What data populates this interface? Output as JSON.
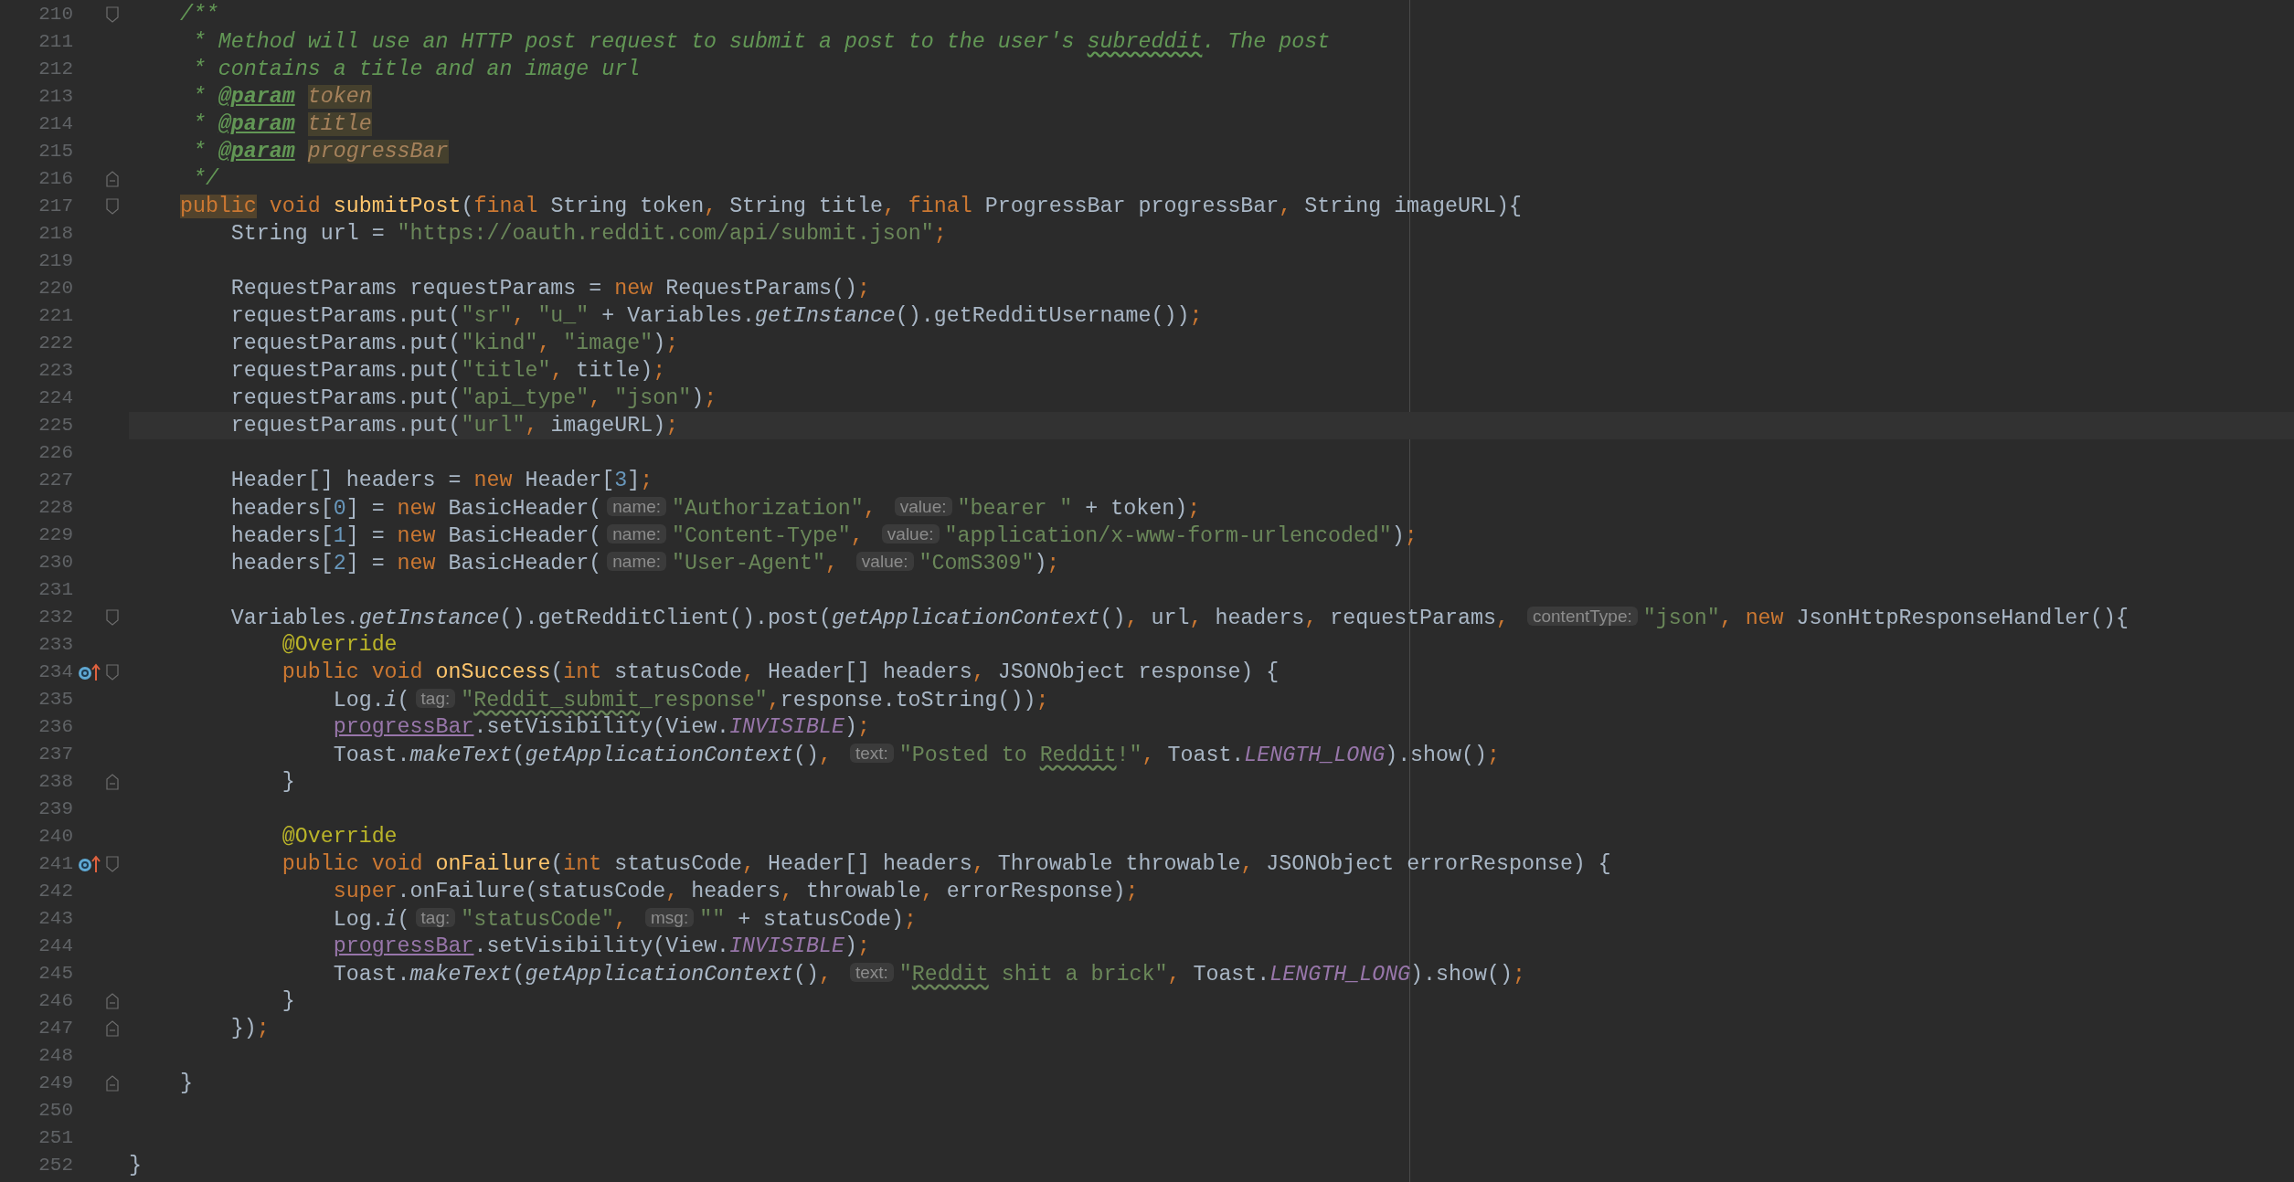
{
  "editor": {
    "lines": [
      {
        "number": "210",
        "fold_start": true,
        "fold_end": false,
        "override": false,
        "current": false,
        "tokens": [
          {
            "kind": "comment",
            "text": "    /**"
          }
        ]
      },
      {
        "number": "211",
        "fold_start": false,
        "fold_end": false,
        "override": false,
        "current": false,
        "tokens": [
          {
            "kind": "comment",
            "text": "     * Method will use an HTTP post request to submit a post to the user's "
          },
          {
            "kind": "comment_typo",
            "text": "subreddit"
          },
          {
            "kind": "comment",
            "text": ". The post"
          }
        ]
      },
      {
        "number": "212",
        "fold_start": false,
        "fold_end": false,
        "override": false,
        "current": false,
        "tokens": [
          {
            "kind": "comment",
            "text": "     * contains a title and an image url"
          }
        ]
      },
      {
        "number": "213",
        "fold_start": false,
        "fold_end": false,
        "override": false,
        "current": false,
        "tokens": [
          {
            "kind": "comment",
            "text": "     * "
          },
          {
            "kind": "doc_tag",
            "text": "@param"
          },
          {
            "kind": "doc_param",
            "text": " token"
          }
        ]
      },
      {
        "number": "214",
        "fold_start": false,
        "fold_end": false,
        "override": false,
        "current": false,
        "tokens": [
          {
            "kind": "comment",
            "text": "     * "
          },
          {
            "kind": "doc_tag",
            "text": "@param"
          },
          {
            "kind": "doc_param",
            "text": " title"
          }
        ]
      },
      {
        "number": "215",
        "fold_start": false,
        "fold_end": false,
        "override": false,
        "current": false,
        "tokens": [
          {
            "kind": "comment",
            "text": "     * "
          },
          {
            "kind": "doc_tag",
            "text": "@param"
          },
          {
            "kind": "doc_param",
            "text": " progressBar"
          }
        ]
      },
      {
        "number": "216",
        "fold_start": false,
        "fold_end": true,
        "override": false,
        "current": false,
        "tokens": [
          {
            "kind": "comment",
            "text": "     */"
          }
        ]
      },
      {
        "number": "217",
        "fold_start": true,
        "fold_end": false,
        "override": false,
        "current": false,
        "tokens": [
          {
            "kind": "keyword_marked",
            "text": "    public"
          },
          {
            "kind": "keyword",
            "text": " void"
          },
          {
            "kind": "declaration",
            "text": " submitPost"
          },
          {
            "kind": "plain",
            "text": "("
          },
          {
            "kind": "keyword",
            "text": "final"
          },
          {
            "kind": "plain",
            "text": " String token"
          },
          {
            "kind": "keyword",
            "text": ","
          },
          {
            "kind": "plain",
            "text": " String title"
          },
          {
            "kind": "keyword",
            "text": ","
          },
          {
            "kind": "keyword",
            "text": " final"
          },
          {
            "kind": "plain",
            "text": " ProgressBar progressBar"
          },
          {
            "kind": "keyword",
            "text": ","
          },
          {
            "kind": "plain",
            "text": " String imageURL){"
          }
        ]
      },
      {
        "number": "218",
        "fold_start": false,
        "fold_end": false,
        "override": false,
        "current": false,
        "tokens": [
          {
            "kind": "plain",
            "text": "        String url = "
          },
          {
            "kind": "string",
            "text": "\"https://oauth.reddit.com/api/submit.json\""
          },
          {
            "kind": "keyword",
            "text": ";"
          }
        ]
      },
      {
        "number": "219",
        "fold_start": false,
        "fold_end": false,
        "override": false,
        "current": false
      },
      {
        "number": "220",
        "fold_start": false,
        "fold_end": false,
        "override": false,
        "current": false,
        "tokens": [
          {
            "kind": "plain",
            "text": "        RequestParams requestParams = "
          },
          {
            "kind": "keyword",
            "text": "new"
          },
          {
            "kind": "plain",
            "text": " RequestParams()"
          },
          {
            "kind": "keyword",
            "text": ";"
          }
        ]
      },
      {
        "number": "221",
        "fold_start": false,
        "fold_end": false,
        "override": false,
        "current": false,
        "tokens": [
          {
            "kind": "plain",
            "text": "        requestParams.put("
          },
          {
            "kind": "string",
            "text": "\"sr\""
          },
          {
            "kind": "keyword",
            "text": ","
          },
          {
            "kind": "string",
            "text": " \"u_\""
          },
          {
            "kind": "plain",
            "text": " + Variables."
          },
          {
            "kind": "static_method",
            "text": "getInstance"
          },
          {
            "kind": "plain",
            "text": "().getRedditUsername())"
          },
          {
            "kind": "keyword",
            "text": ";"
          }
        ]
      },
      {
        "number": "222",
        "fold_start": false,
        "fold_end": false,
        "override": false,
        "current": false,
        "tokens": [
          {
            "kind": "plain",
            "text": "        requestParams.put("
          },
          {
            "kind": "string",
            "text": "\"kind\""
          },
          {
            "kind": "keyword",
            "text": ","
          },
          {
            "kind": "string",
            "text": " \"image\""
          },
          {
            "kind": "plain",
            "text": ")"
          },
          {
            "kind": "keyword",
            "text": ";"
          }
        ]
      },
      {
        "number": "223",
        "fold_start": false,
        "fold_end": false,
        "override": false,
        "current": false,
        "tokens": [
          {
            "kind": "plain",
            "text": "        requestParams.put("
          },
          {
            "kind": "string",
            "text": "\"title\""
          },
          {
            "kind": "keyword",
            "text": ","
          },
          {
            "kind": "plain",
            "text": " title)"
          },
          {
            "kind": "keyword",
            "text": ";"
          }
        ]
      },
      {
        "number": "224",
        "fold_start": false,
        "fold_end": false,
        "override": false,
        "current": false,
        "tokens": [
          {
            "kind": "plain",
            "text": "        requestParams.put("
          },
          {
            "kind": "string",
            "text": "\"api_type\""
          },
          {
            "kind": "keyword",
            "text": ","
          },
          {
            "kind": "string",
            "text": " \"json\""
          },
          {
            "kind": "plain",
            "text": ")"
          },
          {
            "kind": "keyword",
            "text": ";"
          }
        ]
      },
      {
        "number": "225",
        "fold_start": false,
        "fold_end": false,
        "override": false,
        "current": true,
        "tokens": [
          {
            "kind": "plain",
            "text": "        requestParams.put("
          },
          {
            "kind": "string",
            "text": "\"url\""
          },
          {
            "kind": "keyword",
            "text": ","
          },
          {
            "kind": "plain",
            "text": " imageURL)"
          },
          {
            "kind": "keyword",
            "text": ";"
          }
        ]
      },
      {
        "number": "226",
        "fold_start": false,
        "fold_end": false,
        "override": false,
        "current": false
      },
      {
        "number": "227",
        "fold_start": false,
        "fold_end": false,
        "override": false,
        "current": false,
        "tokens": [
          {
            "kind": "plain",
            "text": "        Header[] headers = "
          },
          {
            "kind": "keyword",
            "text": "new"
          },
          {
            "kind": "plain",
            "text": " Header["
          },
          {
            "kind": "number",
            "text": "3"
          },
          {
            "kind": "plain",
            "text": "]"
          },
          {
            "kind": "keyword",
            "text": ";"
          }
        ]
      },
      {
        "number": "228",
        "fold_start": false,
        "fold_end": false,
        "override": false,
        "current": false,
        "tokens": [
          {
            "kind": "plain",
            "text": "        headers["
          },
          {
            "kind": "number",
            "text": "0"
          },
          {
            "kind": "plain",
            "text": "] = "
          },
          {
            "kind": "keyword",
            "text": "new"
          },
          {
            "kind": "plain",
            "text": " BasicHeader("
          },
          {
            "kind": "hint",
            "text": "name:"
          },
          {
            "kind": "string",
            "text": "\"Authorization\""
          },
          {
            "kind": "keyword",
            "text": ","
          },
          {
            "kind": "hint",
            "text": " value:"
          },
          {
            "kind": "string",
            "text": "\"bearer \""
          },
          {
            "kind": "plain",
            "text": " + token)"
          },
          {
            "kind": "keyword",
            "text": ";"
          }
        ]
      },
      {
        "number": "229",
        "fold_start": false,
        "fold_end": false,
        "override": false,
        "current": false,
        "tokens": [
          {
            "kind": "plain",
            "text": "        headers["
          },
          {
            "kind": "number",
            "text": "1"
          },
          {
            "kind": "plain",
            "text": "] = "
          },
          {
            "kind": "keyword",
            "text": "new"
          },
          {
            "kind": "plain",
            "text": " BasicHeader("
          },
          {
            "kind": "hint",
            "text": "name:"
          },
          {
            "kind": "string",
            "text": "\"Content-Type\""
          },
          {
            "kind": "keyword",
            "text": ","
          },
          {
            "kind": "hint",
            "text": " value:"
          },
          {
            "kind": "string",
            "text": "\"application/x-www-form-urlencoded\""
          },
          {
            "kind": "plain",
            "text": ")"
          },
          {
            "kind": "keyword",
            "text": ";"
          }
        ]
      },
      {
        "number": "230",
        "fold_start": false,
        "fold_end": false,
        "override": false,
        "current": false,
        "tokens": [
          {
            "kind": "plain",
            "text": "        headers["
          },
          {
            "kind": "number",
            "text": "2"
          },
          {
            "kind": "plain",
            "text": "] = "
          },
          {
            "kind": "keyword",
            "text": "new"
          },
          {
            "kind": "plain",
            "text": " BasicHeader("
          },
          {
            "kind": "hint",
            "text": "name:"
          },
          {
            "kind": "string",
            "text": "\"User-Agent\""
          },
          {
            "kind": "keyword",
            "text": ","
          },
          {
            "kind": "hint",
            "text": " value:"
          },
          {
            "kind": "string",
            "text": "\"ComS309\""
          },
          {
            "kind": "plain",
            "text": ")"
          },
          {
            "kind": "keyword",
            "text": ";"
          }
        ]
      },
      {
        "number": "231",
        "fold_start": false,
        "fold_end": false,
        "override": false,
        "current": false
      },
      {
        "number": "232",
        "fold_start": true,
        "fold_end": false,
        "override": false,
        "current": false,
        "tokens": [
          {
            "kind": "plain",
            "text": "        Variables."
          },
          {
            "kind": "static_method",
            "text": "getInstance"
          },
          {
            "kind": "plain",
            "text": "().getRedditClient().post("
          },
          {
            "kind": "static_method",
            "text": "getApplicationContext"
          },
          {
            "kind": "plain",
            "text": "()"
          },
          {
            "kind": "keyword",
            "text": ","
          },
          {
            "kind": "plain",
            "text": " url"
          },
          {
            "kind": "keyword",
            "text": ","
          },
          {
            "kind": "plain",
            "text": " headers"
          },
          {
            "kind": "keyword",
            "text": ","
          },
          {
            "kind": "plain",
            "text": " requestParams"
          },
          {
            "kind": "keyword",
            "text": ","
          },
          {
            "kind": "hint",
            "text": " contentType:"
          },
          {
            "kind": "string",
            "text": "\"json\""
          },
          {
            "kind": "keyword",
            "text": ","
          },
          {
            "kind": "keyword",
            "text": " new"
          },
          {
            "kind": "plain",
            "text": " JsonHttpResponseHandler(){"
          }
        ]
      },
      {
        "number": "233",
        "fold_start": false,
        "fold_end": false,
        "override": false,
        "current": false,
        "tokens": [
          {
            "kind": "annotation",
            "text": "            @Override"
          }
        ]
      },
      {
        "number": "234",
        "fold_start": true,
        "fold_end": false,
        "override": true,
        "current": false,
        "tokens": [
          {
            "kind": "keyword",
            "text": "            public"
          },
          {
            "kind": "keyword",
            "text": " void"
          },
          {
            "kind": "declaration",
            "text": " onSuccess"
          },
          {
            "kind": "plain",
            "text": "("
          },
          {
            "kind": "keyword",
            "text": "int"
          },
          {
            "kind": "plain",
            "text": " statusCode"
          },
          {
            "kind": "keyword",
            "text": ","
          },
          {
            "kind": "plain",
            "text": " Header[] headers"
          },
          {
            "kind": "keyword",
            "text": ","
          },
          {
            "kind": "plain",
            "text": " JSONObject response) {"
          }
        ]
      },
      {
        "number": "235",
        "fold_start": false,
        "fold_end": false,
        "override": false,
        "current": false,
        "tokens": [
          {
            "kind": "plain",
            "text": "                Log."
          },
          {
            "kind": "static_method",
            "text": "i"
          },
          {
            "kind": "plain",
            "text": "("
          },
          {
            "kind": "hint",
            "text": "tag:"
          },
          {
            "kind": "string",
            "text": "\""
          },
          {
            "kind": "string_typo",
            "text": "Reddit_submit"
          },
          {
            "kind": "string",
            "text": "_response\""
          },
          {
            "kind": "keyword",
            "text": ","
          },
          {
            "kind": "plain",
            "text": "response.toString())"
          },
          {
            "kind": "keyword",
            "text": ";"
          }
        ]
      },
      {
        "number": "236",
        "fold_start": false,
        "fold_end": false,
        "override": false,
        "current": false,
        "tokens": [
          {
            "kind": "field",
            "text": "                progressBar"
          },
          {
            "kind": "plain",
            "text": ".setVisibility(View."
          },
          {
            "kind": "constant",
            "text": "INVISIBLE"
          },
          {
            "kind": "plain",
            "text": ")"
          },
          {
            "kind": "keyword",
            "text": ";"
          }
        ]
      },
      {
        "number": "237",
        "fold_start": false,
        "fold_end": false,
        "override": false,
        "current": false,
        "tokens": [
          {
            "kind": "plain",
            "text": "                Toast."
          },
          {
            "kind": "static_method",
            "text": "makeText"
          },
          {
            "kind": "plain",
            "text": "("
          },
          {
            "kind": "static_method",
            "text": "getApplicationContext"
          },
          {
            "kind": "plain",
            "text": "()"
          },
          {
            "kind": "keyword",
            "text": ","
          },
          {
            "kind": "hint",
            "text": " text:"
          },
          {
            "kind": "string",
            "text": "\"Posted to "
          },
          {
            "kind": "string_typo",
            "text": "Reddit"
          },
          {
            "kind": "string",
            "text": "!\""
          },
          {
            "kind": "keyword",
            "text": ","
          },
          {
            "kind": "plain",
            "text": " Toast."
          },
          {
            "kind": "constant",
            "text": "LENGTH_LONG"
          },
          {
            "kind": "plain",
            "text": ").show()"
          },
          {
            "kind": "keyword",
            "text": ";"
          }
        ]
      },
      {
        "number": "238",
        "fold_start": false,
        "fold_end": true,
        "override": false,
        "current": false,
        "tokens": [
          {
            "kind": "plain",
            "text": "            }"
          }
        ]
      },
      {
        "number": "239",
        "fold_start": false,
        "fold_end": false,
        "override": false,
        "current": false
      },
      {
        "number": "240",
        "fold_start": false,
        "fold_end": false,
        "override": false,
        "current": false,
        "tokens": [
          {
            "kind": "annotation",
            "text": "            @Override"
          }
        ]
      },
      {
        "number": "241",
        "fold_start": true,
        "fold_end": false,
        "override": true,
        "current": false,
        "tokens": [
          {
            "kind": "keyword",
            "text": "            public"
          },
          {
            "kind": "keyword",
            "text": " void"
          },
          {
            "kind": "declaration",
            "text": " onFailure"
          },
          {
            "kind": "plain",
            "text": "("
          },
          {
            "kind": "keyword",
            "text": "int"
          },
          {
            "kind": "plain",
            "text": " statusCode"
          },
          {
            "kind": "keyword",
            "text": ","
          },
          {
            "kind": "plain",
            "text": " Header[] headers"
          },
          {
            "kind": "keyword",
            "text": ","
          },
          {
            "kind": "plain",
            "text": " Throwable throwable"
          },
          {
            "kind": "keyword",
            "text": ","
          },
          {
            "kind": "plain",
            "text": " JSONObject errorResponse) {"
          }
        ]
      },
      {
        "number": "242",
        "fold_start": false,
        "fold_end": false,
        "override": false,
        "current": false,
        "tokens": [
          {
            "kind": "keyword",
            "text": "                super"
          },
          {
            "kind": "plain",
            "text": ".onFailure(statusCode"
          },
          {
            "kind": "keyword",
            "text": ","
          },
          {
            "kind": "plain",
            "text": " headers"
          },
          {
            "kind": "keyword",
            "text": ","
          },
          {
            "kind": "plain",
            "text": " throwable"
          },
          {
            "kind": "keyword",
            "text": ","
          },
          {
            "kind": "plain",
            "text": " errorResponse)"
          },
          {
            "kind": "keyword",
            "text": ";"
          }
        ]
      },
      {
        "number": "243",
        "fold_start": false,
        "fold_end": false,
        "override": false,
        "current": false,
        "tokens": [
          {
            "kind": "plain",
            "text": "                Log."
          },
          {
            "kind": "static_method",
            "text": "i"
          },
          {
            "kind": "plain",
            "text": "("
          },
          {
            "kind": "hint",
            "text": "tag:"
          },
          {
            "kind": "string",
            "text": "\"statusCode\""
          },
          {
            "kind": "keyword",
            "text": ","
          },
          {
            "kind": "hint",
            "text": " msg:"
          },
          {
            "kind": "string",
            "text": "\"\""
          },
          {
            "kind": "plain",
            "text": " + statusCode)"
          },
          {
            "kind": "keyword",
            "text": ";"
          }
        ]
      },
      {
        "number": "244",
        "fold_start": false,
        "fold_end": false,
        "override": false,
        "current": false,
        "tokens": [
          {
            "kind": "field",
            "text": "                progressBar"
          },
          {
            "kind": "plain",
            "text": ".setVisibility(View."
          },
          {
            "kind": "constant",
            "text": "INVISIBLE"
          },
          {
            "kind": "plain",
            "text": ")"
          },
          {
            "kind": "keyword",
            "text": ";"
          }
        ]
      },
      {
        "number": "245",
        "fold_start": false,
        "fold_end": false,
        "override": false,
        "current": false,
        "tokens": [
          {
            "kind": "plain",
            "text": "                Toast."
          },
          {
            "kind": "static_method",
            "text": "makeText"
          },
          {
            "kind": "plain",
            "text": "("
          },
          {
            "kind": "static_method",
            "text": "getApplicationContext"
          },
          {
            "kind": "plain",
            "text": "()"
          },
          {
            "kind": "keyword",
            "text": ","
          },
          {
            "kind": "hint",
            "text": " text:"
          },
          {
            "kind": "string",
            "text": "\""
          },
          {
            "kind": "string_typo",
            "text": "Reddit"
          },
          {
            "kind": "string",
            "text": " shit a brick\""
          },
          {
            "kind": "keyword",
            "text": ","
          },
          {
            "kind": "plain",
            "text": " Toast."
          },
          {
            "kind": "constant",
            "text": "LENGTH_LONG"
          },
          {
            "kind": "plain",
            "text": ").show()"
          },
          {
            "kind": "keyword",
            "text": ";"
          }
        ]
      },
      {
        "number": "246",
        "fold_start": false,
        "fold_end": true,
        "override": false,
        "current": false,
        "tokens": [
          {
            "kind": "plain",
            "text": "            }"
          }
        ]
      },
      {
        "number": "247",
        "fold_start": false,
        "fold_end": true,
        "override": false,
        "current": false,
        "tokens": [
          {
            "kind": "plain",
            "text": "        })"
          },
          {
            "kind": "keyword",
            "text": ";"
          }
        ]
      },
      {
        "number": "248",
        "fold_start": false,
        "fold_end": false,
        "override": false,
        "current": false
      },
      {
        "number": "249",
        "fold_start": false,
        "fold_end": true,
        "override": false,
        "current": false,
        "tokens": [
          {
            "kind": "plain",
            "text": "    }"
          }
        ]
      },
      {
        "number": "250",
        "fold_start": false,
        "fold_end": false,
        "override": false,
        "current": false
      },
      {
        "number": "251",
        "fold_start": false,
        "fold_end": false,
        "override": false,
        "current": false
      },
      {
        "number": "252",
        "fold_start": false,
        "fold_end": false,
        "override": false,
        "current": false,
        "tokens": [
          {
            "kind": "plain",
            "text": "}"
          }
        ]
      }
    ]
  }
}
